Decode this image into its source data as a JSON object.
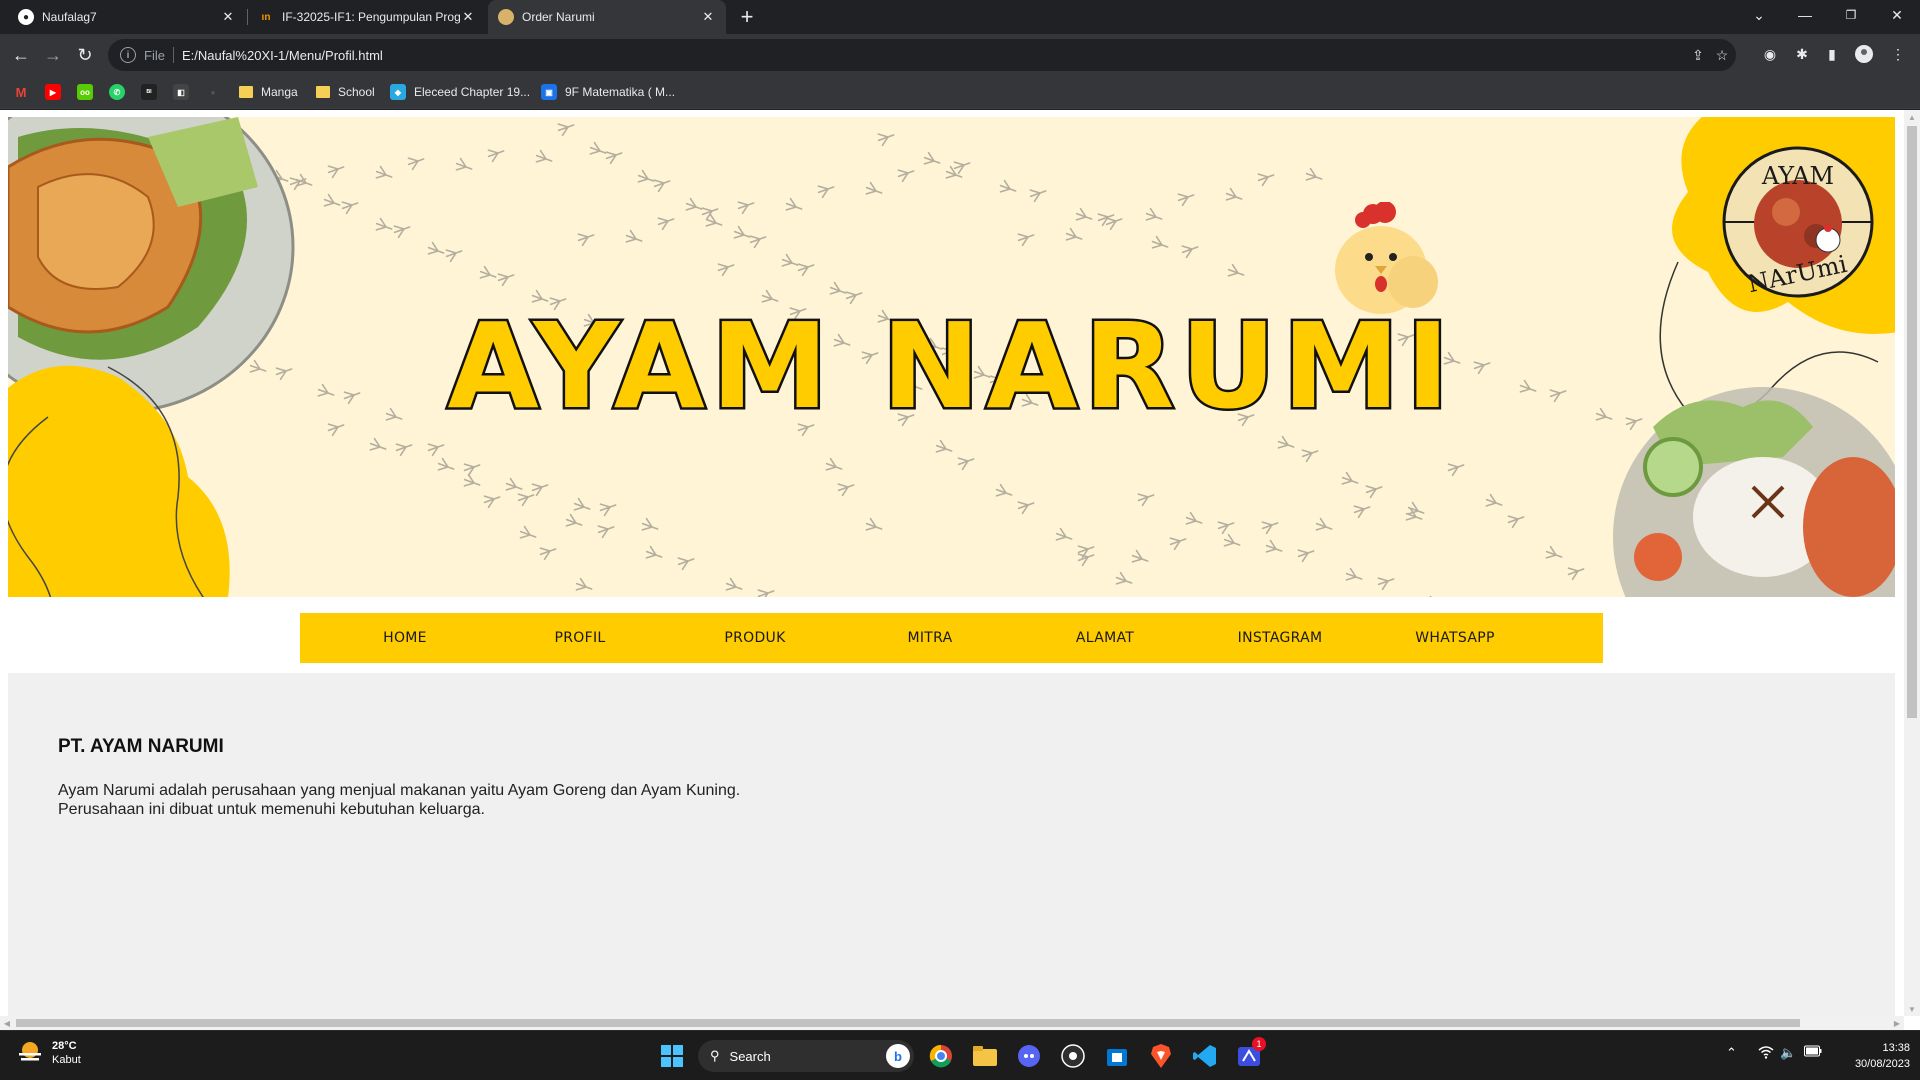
{
  "browser": {
    "tabs": [
      {
        "title": "Naufalag7",
        "icon": "github-icon"
      },
      {
        "title": "IF-32025-IF1: Pengumpulan Prog",
        "icon": "course-icon"
      },
      {
        "title": "Order Narumi",
        "icon": "chicken-favicon"
      }
    ],
    "address": {
      "scheme": "File",
      "url": "E:/Naufal%20XI-1/Menu/Profil.html"
    },
    "bookmarks": [
      {
        "label": "Manga",
        "type": "folder"
      },
      {
        "label": "School",
        "type": "folder"
      },
      {
        "label": "Eleceed Chapter 19...",
        "type": "link"
      },
      {
        "label": "9F Matematika ( M...",
        "type": "link"
      }
    ]
  },
  "page": {
    "hero_title": "AYAM NARUMI",
    "logo_top": "AYAM",
    "logo_bottom": "NArUmi",
    "nav": [
      "HOME",
      "PROFIL",
      "PRODUK",
      "MITRA",
      "ALAMAT",
      "INSTAGRAM",
      "WHATSAPP"
    ],
    "heading": "PT. AYAM NARUMI",
    "paragraph_1": "Ayam Narumi adalah perusahaan yang menjual makanan yaitu Ayam Goreng dan Ayam Kuning.",
    "paragraph_2": "Perusahaan ini dibuat untuk memenuhi kebutuhan keluarga."
  },
  "taskbar": {
    "weather_temp": "28°C",
    "weather_desc": "Kabut",
    "search_placeholder": "Search",
    "time": "13:38",
    "date": "30/08/2023",
    "notification_badge": "1"
  },
  "colors": {
    "accent_yellow": "#ffcc00",
    "hero_bg": "#fff4d6",
    "content_bg": "#f0f0f0"
  }
}
